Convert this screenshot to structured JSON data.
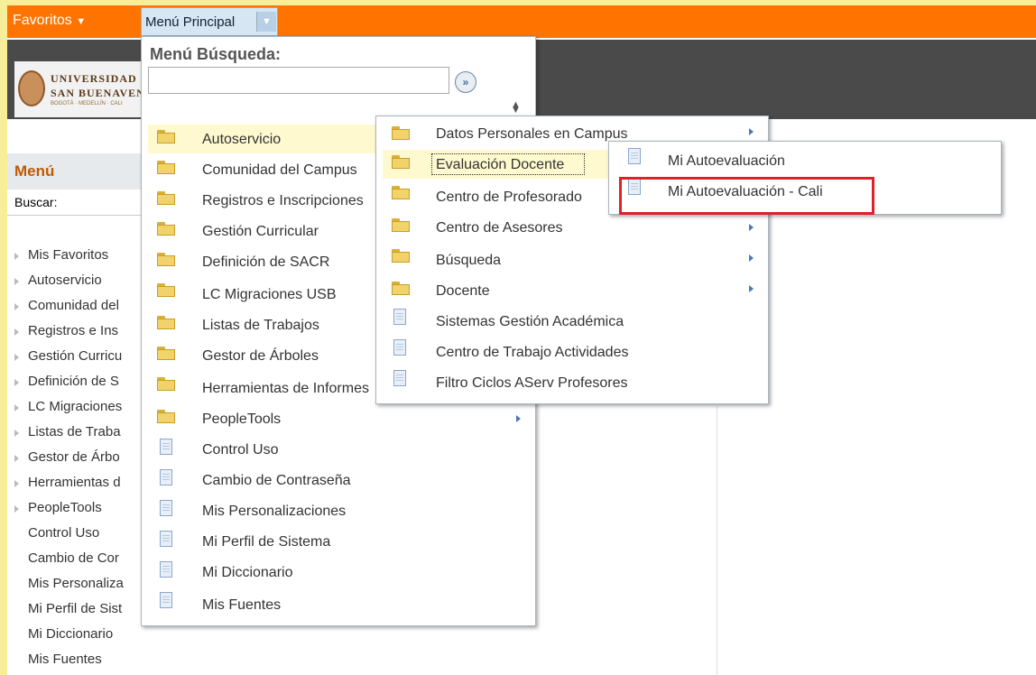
{
  "navbar": {
    "favorites_label": "Favoritos",
    "main_menu_label": "Menú Principal"
  },
  "logo": {
    "line1": "UNIVERSIDAD",
    "line2": "SAN BUENAVENTURA",
    "line3": "BOGOTÁ · MEDELLÍN · CALI"
  },
  "left_menu": {
    "title": "Menú",
    "search_label": "Buscar:",
    "items": [
      {
        "label": "Mis Favoritos"
      },
      {
        "label": "Autoservicio"
      },
      {
        "label": "Comunidad del"
      },
      {
        "label": "Registros e Ins"
      },
      {
        "label": "Gestión Curricu"
      },
      {
        "label": "Definición de S"
      },
      {
        "label": "LC Migraciones"
      },
      {
        "label": "Listas de Traba"
      },
      {
        "label": "Gestor de Árbo"
      },
      {
        "label": "Herramientas d"
      },
      {
        "label": "PeopleTools"
      },
      {
        "label": "Control Uso"
      },
      {
        "label": "Cambio de Cor"
      },
      {
        "label": "Mis Personaliza"
      },
      {
        "label": "Mi Perfil de Sist"
      },
      {
        "label": "Mi Diccionario"
      },
      {
        "label": "Mis Fuentes"
      }
    ]
  },
  "main_dropdown": {
    "title": "Menú Búsqueda:",
    "search_value": "",
    "items": [
      {
        "label": "Autoservicio",
        "icon": "folder"
      },
      {
        "label": "Comunidad del Campus",
        "icon": "folder"
      },
      {
        "label": "Registros e Inscripciones",
        "icon": "folder"
      },
      {
        "label": "Gestión Curricular",
        "icon": "folder"
      },
      {
        "label": "Definición de SACR",
        "icon": "folder"
      },
      {
        "label": "LC Migraciones USB",
        "icon": "folder"
      },
      {
        "label": "Listas de Trabajos",
        "icon": "folder"
      },
      {
        "label": "Gestor de Árboles",
        "icon": "folder"
      },
      {
        "label": "Herramientas de Informes",
        "icon": "folder"
      },
      {
        "label": "PeopleTools",
        "icon": "folder"
      },
      {
        "label": "Control Uso",
        "icon": "document"
      },
      {
        "label": "Cambio de Contraseña",
        "icon": "document"
      },
      {
        "label": "Mis Personalizaciones",
        "icon": "document"
      },
      {
        "label": "Mi Perfil de Sistema",
        "icon": "document"
      },
      {
        "label": "Mi Diccionario",
        "icon": "document"
      },
      {
        "label": "Mis Fuentes",
        "icon": "document"
      }
    ]
  },
  "submenu_autoservicio": {
    "items": [
      {
        "label": "Datos Personales en Campus",
        "icon": "folder"
      },
      {
        "label": "Evaluación Docente",
        "icon": "folder"
      },
      {
        "label": "Centro de Profesorado",
        "icon": "folder"
      },
      {
        "label": "Centro de Asesores",
        "icon": "folder"
      },
      {
        "label": "Búsqueda",
        "icon": "folder"
      },
      {
        "label": "Docente",
        "icon": "folder"
      },
      {
        "label": "Sistemas Gestión Académica",
        "icon": "document"
      },
      {
        "label": "Centro de Trabajo Actividades",
        "icon": "document"
      },
      {
        "label": "Filtro Ciclos AServ Profesores",
        "icon": "document"
      }
    ]
  },
  "submenu_evaluacion": {
    "items": [
      {
        "label": "Mi Autoevaluación",
        "icon": "document"
      },
      {
        "label": "Mi Autoevaluación - Cali",
        "icon": "document"
      }
    ]
  },
  "colors": {
    "navbar": "#ff7400",
    "header": "#4a4a4a",
    "highlight": "#fff9cf",
    "callout": "#e0202a"
  }
}
